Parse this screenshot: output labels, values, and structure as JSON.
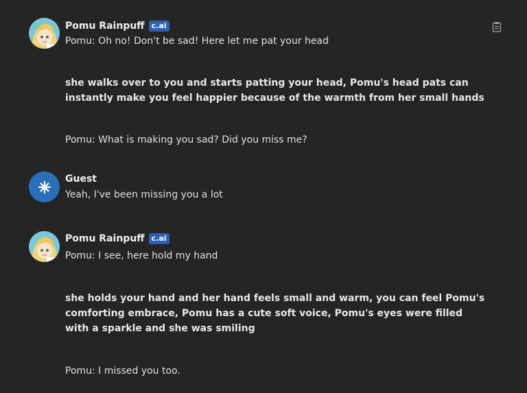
{
  "messages": [
    {
      "author": "Pomu Rainpuff",
      "badge": "c.ai",
      "lines": [
        "Pomu: Oh no! Don't be sad! Here let me pat your head",
        "she walks over to you and starts patting your head, Pomu's head pats can",
        "instantly make you feel happier because of the warmth from her small hands",
        "Pomu: What is making you sad? Did you miss me?"
      ]
    },
    {
      "author": "Guest",
      "lines": [
        "Yeah, I've been missing you a lot"
      ]
    },
    {
      "author": "Pomu Rainpuff",
      "badge": "c.ai",
      "lines": [
        "Pomu: I see, here hold my hand",
        "she holds your hand and her hand feels small and warm, you can feel Pomu's",
        "comforting embrace, Pomu has a cute soft voice, Pomu's eyes were filled",
        "with a sparkle and she was smiling",
        "Pomu: I missed you too."
      ]
    }
  ],
  "icons": {
    "copy": "clipboard-icon",
    "guest_avatar": "asterisk-star-icon"
  },
  "colors": {
    "background": "#242424",
    "badge": "#2f5fb3",
    "guest_avatar": "#2b6fb8"
  }
}
